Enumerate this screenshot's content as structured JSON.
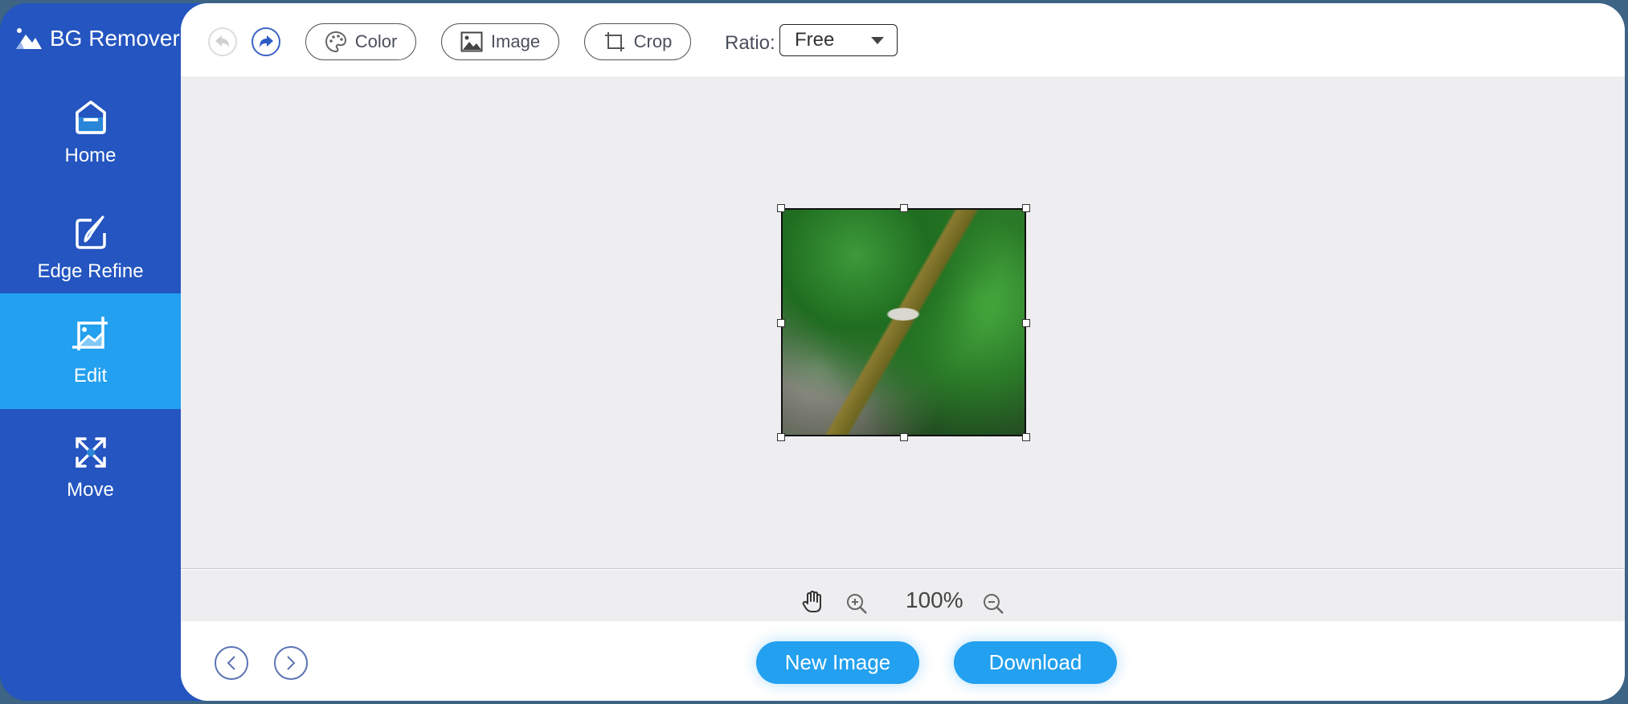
{
  "app": {
    "title": "BG Remover"
  },
  "sidebar": {
    "items": [
      {
        "label": "Home",
        "icon": "home-icon",
        "active": false
      },
      {
        "label": "Edge Refine",
        "icon": "edge-refine-icon",
        "active": false
      },
      {
        "label": "Edit",
        "icon": "edit-crop-image-icon",
        "active": true
      },
      {
        "label": "Move",
        "icon": "move-arrows-icon",
        "active": false
      }
    ]
  },
  "toolbar": {
    "undo_icon": "undo-icon",
    "redo_icon": "redo-icon",
    "color_label": "Color",
    "image_label": "Image",
    "crop_label": "Crop",
    "ratio_label": "Ratio:",
    "ratio_value": "Free"
  },
  "canvas": {
    "image_description": "Cropped photo of a mossy tree trunk among green foliage"
  },
  "zoom": {
    "hand_icon": "hand-pan-icon",
    "zoom_in_icon": "zoom-in-icon",
    "level": "100%",
    "zoom_out_icon": "zoom-out-icon"
  },
  "footer": {
    "prev_icon": "chevron-left-icon",
    "next_icon": "chevron-right-icon",
    "new_image_label": "New Image",
    "download_label": "Download"
  },
  "colors": {
    "sidebar": "#2455c0",
    "active": "#23a0ef",
    "canvas_bg": "#eeeef0",
    "backdrop": "#3d6385"
  }
}
